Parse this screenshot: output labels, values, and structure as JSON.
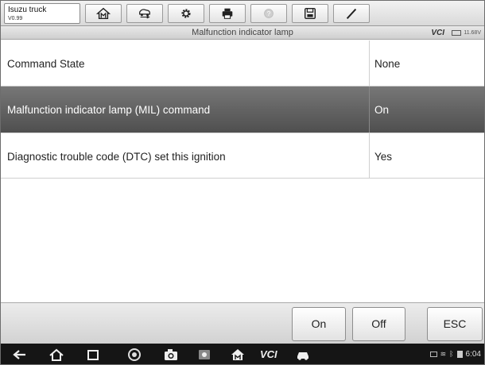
{
  "toolbar": {
    "vehicle_name": "Isuzu truck",
    "vehicle_version": "V0.99",
    "buttons": [
      "home-icon",
      "car-swap-icon",
      "gear-icon",
      "printer-icon",
      "help-icon",
      "save-icon",
      "pen-icon"
    ]
  },
  "header": {
    "title": "Malfunction indicator lamp",
    "vci_label": "VCI",
    "battery_voltage": "11.68V"
  },
  "table": {
    "rows": [
      {
        "name": "Command State",
        "value": "None",
        "selected": false
      },
      {
        "name": "Malfunction indicator lamp (MIL) command",
        "value": "On",
        "selected": true
      },
      {
        "name": "Diagnostic trouble code (DTC) set this ignition",
        "value": "Yes",
        "selected": false
      }
    ]
  },
  "actions": {
    "on_label": "On",
    "off_label": "Off",
    "esc_label": "ESC"
  },
  "navbar": {
    "vci_label": "VCI",
    "clock": "6:04"
  },
  "colors": {
    "selected_row_top": "#777777",
    "selected_row_bottom": "#4f4f4f",
    "navbar_bg": "#151515"
  }
}
